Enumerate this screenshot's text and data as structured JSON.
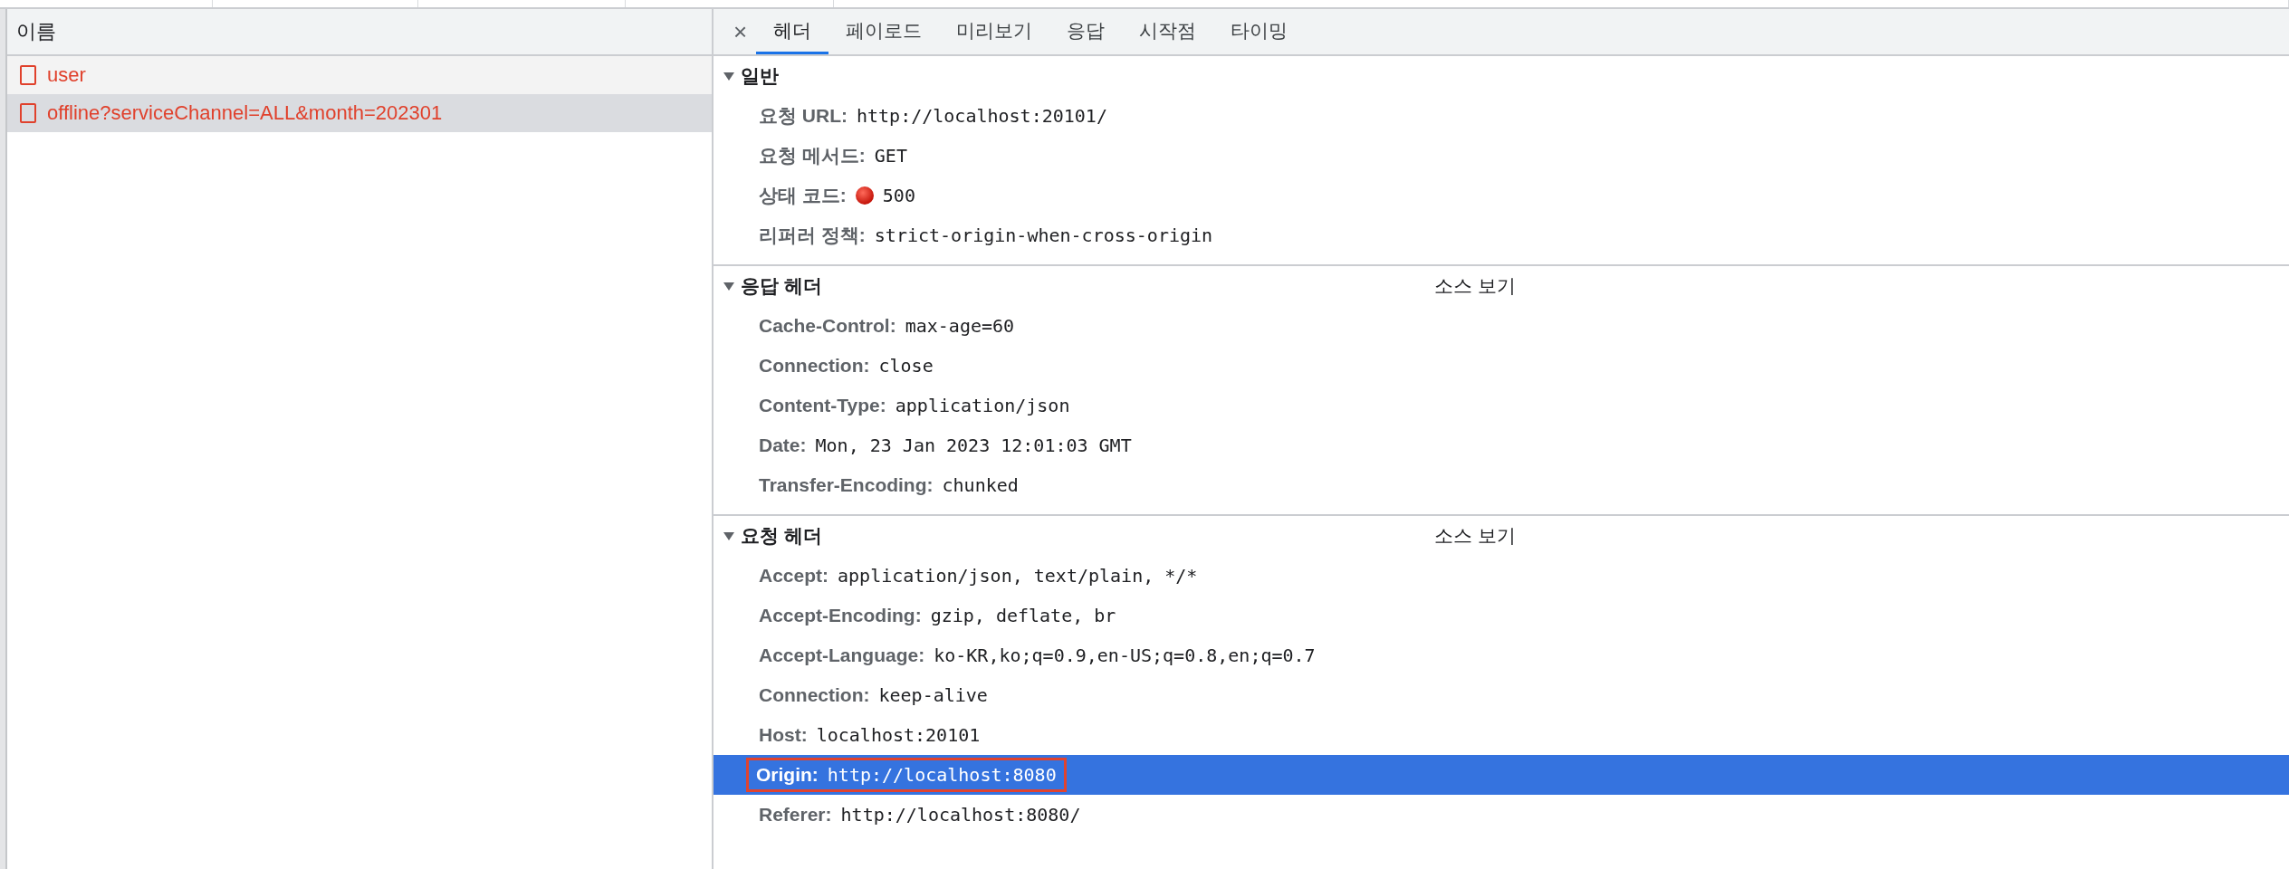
{
  "requests": {
    "column": "이름",
    "items": [
      {
        "name": "user",
        "selected": false
      },
      {
        "name": "offline?serviceChannel=ALL&month=202301",
        "selected": true
      }
    ]
  },
  "details": {
    "close": "×",
    "tabs": [
      {
        "label": "헤더",
        "selected": true
      },
      {
        "label": "페이로드",
        "selected": false
      },
      {
        "label": "미리보기",
        "selected": false
      },
      {
        "label": "응답",
        "selected": false
      },
      {
        "label": "시작점",
        "selected": false
      },
      {
        "label": "타이밍",
        "selected": false
      }
    ],
    "sections": [
      {
        "title": "일반",
        "expanded": true,
        "rows": [
          {
            "name": "요청 URL:",
            "value": "http://localhost:20101/",
            "selected": false,
            "annotated": false
          },
          {
            "name": "요청 메서드:",
            "value": "GET",
            "selected": false,
            "annotated": false
          },
          {
            "name": "상태 코드:",
            "value": "500",
            "error": true,
            "selected": false,
            "annotated": false
          },
          {
            "name": "리퍼러 정책:",
            "value": "strict-origin-when-cross-origin",
            "selected": false,
            "annotated": false
          }
        ]
      },
      {
        "title": "응답 헤더",
        "link": "소스 보기",
        "expanded": true,
        "rows": [
          {
            "name": "Cache-Control:",
            "value": "max-age=60",
            "selected": false,
            "annotated": false
          },
          {
            "name": "Connection:",
            "value": "close",
            "selected": false,
            "annotated": false
          },
          {
            "name": "Content-Type:",
            "value": "application/json",
            "selected": false,
            "annotated": false
          },
          {
            "name": "Date:",
            "value": "Mon, 23 Jan 2023 12:01:03 GMT",
            "selected": false,
            "annotated": false
          },
          {
            "name": "Transfer-Encoding:",
            "value": "chunked",
            "selected": false,
            "annotated": false
          }
        ]
      },
      {
        "title": "요청 헤더",
        "link": "소스 보기",
        "expanded": true,
        "rows": [
          {
            "name": "Accept:",
            "value": "application/json, text/plain, */*",
            "selected": false,
            "annotated": false
          },
          {
            "name": "Accept-Encoding:",
            "value": "gzip, deflate, br",
            "selected": false,
            "annotated": false
          },
          {
            "name": "Accept-Language:",
            "value": "ko-KR,ko;q=0.9,en-US;q=0.8,en;q=0.7",
            "selected": false,
            "annotated": false
          },
          {
            "name": "Connection:",
            "value": "keep-alive",
            "selected": false,
            "annotated": false
          },
          {
            "name": "Host:",
            "value": "localhost:20101",
            "selected": false,
            "annotated": false
          },
          {
            "name": "Origin:",
            "value": "http://localhost:8080",
            "selected": true,
            "annotated": true
          },
          {
            "name": "Referer:",
            "value": "http://localhost:8080/",
            "selected": false,
            "annotated": false
          }
        ]
      }
    ]
  }
}
